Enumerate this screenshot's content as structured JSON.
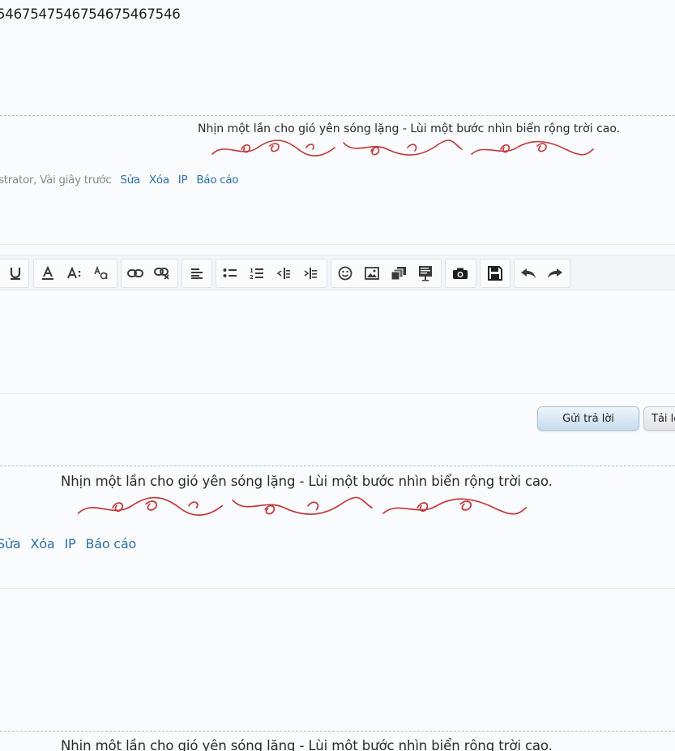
{
  "post_top": {
    "message_fragment": "5467547546754675467546"
  },
  "signature": {
    "text": "Nhịn một lần cho gió yên sóng lặng - Lùi một bước nhìn biển rộng trời cao."
  },
  "post_meta": {
    "author_fragment": "strator, Vài giây trước",
    "edit_label": "Sửa",
    "delete_label": "Xóa",
    "ip_label": "IP",
    "report_label": "Báo cáo"
  },
  "toolbar": {
    "buttons": [
      {
        "group": 1,
        "icon": "underline-icon"
      },
      {
        "group": 2,
        "icon": "font-color-icon"
      },
      {
        "group": 2,
        "icon": "font-size-icon"
      },
      {
        "group": 2,
        "icon": "font-family-icon"
      },
      {
        "group": 3,
        "icon": "link-icon"
      },
      {
        "group": 3,
        "icon": "unlink-icon"
      },
      {
        "group": 4,
        "icon": "align-icon"
      },
      {
        "group": 5,
        "icon": "bullet-list-icon"
      },
      {
        "group": 5,
        "icon": "numbered-list-icon"
      },
      {
        "group": 5,
        "icon": "outdent-icon"
      },
      {
        "group": 5,
        "icon": "indent-icon"
      },
      {
        "group": 6,
        "icon": "smiley-icon"
      },
      {
        "group": 6,
        "icon": "image-icon"
      },
      {
        "group": 6,
        "icon": "media-icon"
      },
      {
        "group": 6,
        "icon": "insert-icon"
      },
      {
        "group": 7,
        "icon": "camera-icon"
      },
      {
        "group": 8,
        "icon": "save-icon"
      },
      {
        "group": 9,
        "icon": "undo-icon"
      },
      {
        "group": 9,
        "icon": "redo-icon"
      }
    ]
  },
  "reply_form": {
    "submit_label": "Gửi trả lời",
    "upload_label": "Tải lê"
  },
  "colors": {
    "background": "#fafbfd",
    "link": "#2c6fa3",
    "flourish": "#c0393b",
    "dashed_divider": "#a9c4da"
  }
}
